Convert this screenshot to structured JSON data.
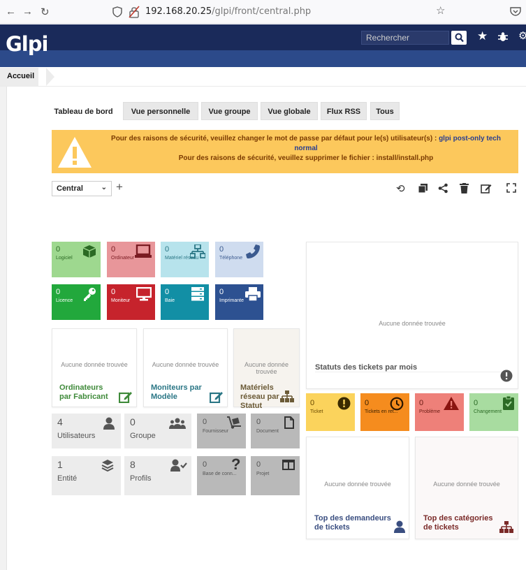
{
  "browser": {
    "url_host": "192.168.20.25",
    "url_path": "/glpi/front/central.php"
  },
  "header": {
    "logo": "Glpi",
    "search_placeholder": "Rechercher"
  },
  "breadcrumb": "Accueil",
  "tabs": [
    "Tableau de bord",
    "Vue personnelle",
    "Vue groupe",
    "Vue globale",
    "Flux RSS",
    "Tous"
  ],
  "warning": {
    "line1_prefix": "Pour des raisons de sécurité, veuillez changer le mot de passe par défaut pour le(s) utilisateur(s) :",
    "line1_link": "glpi post-only tech",
    "line1_suffix": "normal",
    "line2": "Pour des raisons de sécurité, veuillez supprimer le fichier : install/install.php"
  },
  "dashboard": {
    "selected": "Central"
  },
  "asset_cards": [
    {
      "value": "0",
      "label": "Logiciel",
      "bg": "#9ed88f",
      "fg": "#2b6a24",
      "icon": "box-icon"
    },
    {
      "value": "0",
      "label": "Ordinateur",
      "bg": "#e8969a",
      "fg": "#7a1b22",
      "icon": "laptop-icon"
    },
    {
      "value": "0",
      "label": "Matériel réseau",
      "bg": "#b7e3ec",
      "fg": "#2a7685",
      "icon": "network-icon"
    },
    {
      "value": "0",
      "label": "Téléphone",
      "bg": "#cfdcef",
      "fg": "#3b5a8f",
      "icon": "phone-icon"
    },
    {
      "value": "0",
      "label": "Licence",
      "bg": "#22a83c",
      "fg": "#ffffff",
      "icon": "key-icon"
    },
    {
      "value": "0",
      "label": "Moniteur",
      "bg": "#c6232c",
      "fg": "#ffffff",
      "icon": "monitor-icon"
    },
    {
      "value": "0",
      "label": "Baie",
      "bg": "#128fa5",
      "fg": "#ffffff",
      "icon": "rack-icon"
    },
    {
      "value": "0",
      "label": "Imprimante",
      "bg": "#2d5191",
      "fg": "#ffffff",
      "icon": "printer-icon"
    }
  ],
  "nodata_text": "Aucune donnée trouvée",
  "chart_cards": [
    {
      "title": "Ordinateurs par Fabricant",
      "color": "#3f8a3a",
      "icon": "edit-icon"
    },
    {
      "title": "Moniteurs par Modèle",
      "color": "#2a7685",
      "icon": "edit-icon"
    },
    {
      "title": "Matériels réseau par Statut",
      "color": "#6b5a36",
      "icon": "sitemap-icon"
    }
  ],
  "tickets_month": {
    "title": "Statuts des tickets par mois"
  },
  "ticket_cards": [
    {
      "value": "0",
      "label": "Ticket",
      "bg": "#fbd35c",
      "fg": "#6a4a00",
      "icon": "alert-icon"
    },
    {
      "value": "0",
      "label": "Tickets en ret...",
      "bg": "#f58c1e",
      "fg": "#3a2000",
      "icon": "clock-icon"
    },
    {
      "value": "0",
      "label": "Problème",
      "bg": "#ee8079",
      "fg": "#6a1a12",
      "icon": "warning-icon"
    },
    {
      "value": "0",
      "label": "Changement",
      "bg": "#a8dca0",
      "fg": "#2b6a24",
      "icon": "clipboard-check-icon"
    }
  ],
  "grey_cards": [
    {
      "value": "4",
      "label": "Utilisateurs",
      "bg": "#ececec",
      "icon": "user-icon"
    },
    {
      "value": "0",
      "label": "Groupe",
      "bg": "#ececec",
      "icon": "users-icon"
    },
    {
      "value": "0",
      "label": "Fournisseur",
      "bg": "#b9b9b9",
      "icon": "dolly-icon"
    },
    {
      "value": "0",
      "label": "Document",
      "bg": "#b9b9b9",
      "icon": "file-icon"
    },
    {
      "value": "1",
      "label": "Entité",
      "bg": "#ececec",
      "icon": "layers-icon"
    },
    {
      "value": "8",
      "label": "Profils",
      "bg": "#ececec",
      "icon": "user-check-icon"
    },
    {
      "value": "0",
      "label": "Base de conn...",
      "bg": "#b9b9b9",
      "icon": "question-icon"
    },
    {
      "value": "0",
      "label": "Projet",
      "bg": "#b9b9b9",
      "icon": "columns-icon"
    }
  ],
  "top_cards": [
    {
      "title": "Top des demandeurs de tickets",
      "color": "#3a4e80",
      "icon": "user-icon"
    },
    {
      "title": "Top des catégories de tickets",
      "color": "#7a2a28",
      "icon": "sitemap-icon"
    }
  ]
}
